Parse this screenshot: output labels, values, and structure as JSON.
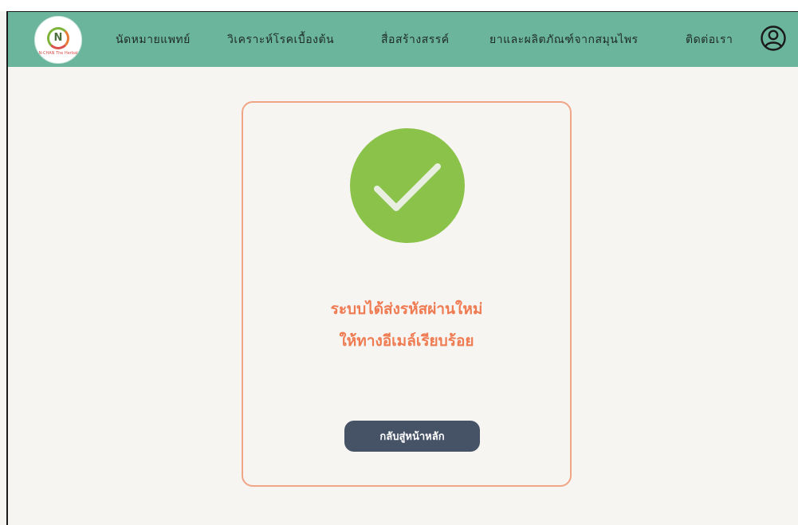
{
  "logo": {
    "alt": "logo",
    "caption": "N-CHAN\nThe Herbal",
    "icon": "herbal-logo-icon"
  },
  "nav": {
    "items": [
      {
        "label": "นัดหมายแพทย์"
      },
      {
        "label": "วิเคราะห์โรคเบื้องต้น"
      },
      {
        "label": "สื่อสร้างสรรค์"
      },
      {
        "label": "ยาและผลิตภัณฑ์จากสมุนไพร"
      },
      {
        "label": "ติดต่อเรา"
      }
    ],
    "user_icon": "user-circle-icon"
  },
  "card": {
    "icon": "check-circle-icon",
    "message_line1": "ระบบได้ส่งรหัสผ่านใหม่",
    "message_line2": "ให้ทางอีเมล์เรียบร้อย",
    "button_label": "กลับสู่หน้าหลัก"
  },
  "colors": {
    "navbar": "#6bb59c",
    "accent": "#ef7b52",
    "card_border": "#f0a587",
    "success": "#8bc34a",
    "button": "#465266",
    "background": "#f7f5f1"
  }
}
